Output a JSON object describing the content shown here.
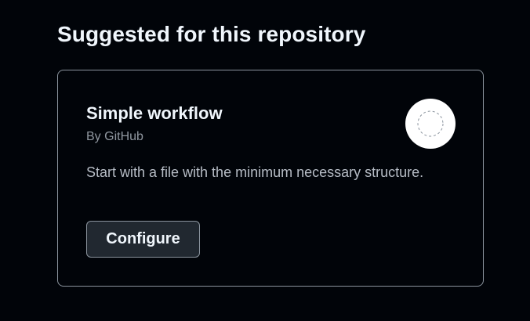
{
  "section": {
    "title": "Suggested for this repository"
  },
  "workflow_card": {
    "title": "Simple workflow",
    "author": "By GitHub",
    "description": "Start with a file with the minimum necessary structure.",
    "configure_label": "Configure",
    "logo_icon": "dashed-circle-icon"
  },
  "colors": {
    "background": "#010409",
    "card_border": "#8b949e",
    "button_bg": "#212830",
    "text_primary": "#f0f6fc",
    "text_muted": "#9198a1"
  }
}
